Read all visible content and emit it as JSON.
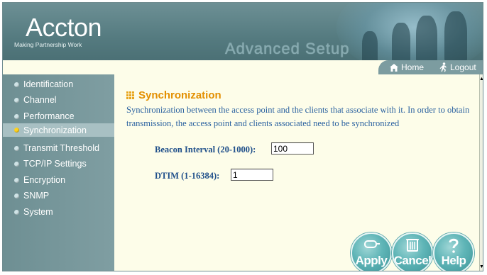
{
  "header": {
    "logo": "Accton",
    "tagline": "Making Partnership Work",
    "title": "Advanced Setup"
  },
  "topnav": {
    "home_label": "Home",
    "logout_label": "Logout"
  },
  "sidebar": {
    "items": [
      {
        "label": "Identification",
        "active": false
      },
      {
        "label": "Channel",
        "active": false
      },
      {
        "label": "Performance",
        "active": false
      },
      {
        "label": "Synchronization",
        "active": true
      },
      {
        "label": "Transmit Threshold",
        "active": false
      },
      {
        "label": "TCP/IP Settings",
        "active": false
      },
      {
        "label": "Encryption",
        "active": false
      },
      {
        "label": "SNMP",
        "active": false
      },
      {
        "label": "System",
        "active": false
      }
    ]
  },
  "main": {
    "section_title": "Synchronization",
    "description": "Synchronization between the access point and the clients that associate with it. In order to obtain transmission, the access point and clients associated need to be synchronized",
    "fields": {
      "beacon": {
        "label": "Beacon Interval (20-1000):",
        "value": "100"
      },
      "dtim": {
        "label": "DTIM (1-16384):",
        "value": "1"
      }
    },
    "buttons": {
      "apply": "Apply",
      "cancel": "Cancel",
      "help": "Help"
    }
  },
  "colors": {
    "header_bg": "#557b80",
    "sidebar_bg": "#7f9ea2",
    "active_item_bg": "#a8c0c3",
    "title_orange": "#e38f00",
    "text_blue": "#2b62a0",
    "button_teal": "#5fb5b7"
  }
}
